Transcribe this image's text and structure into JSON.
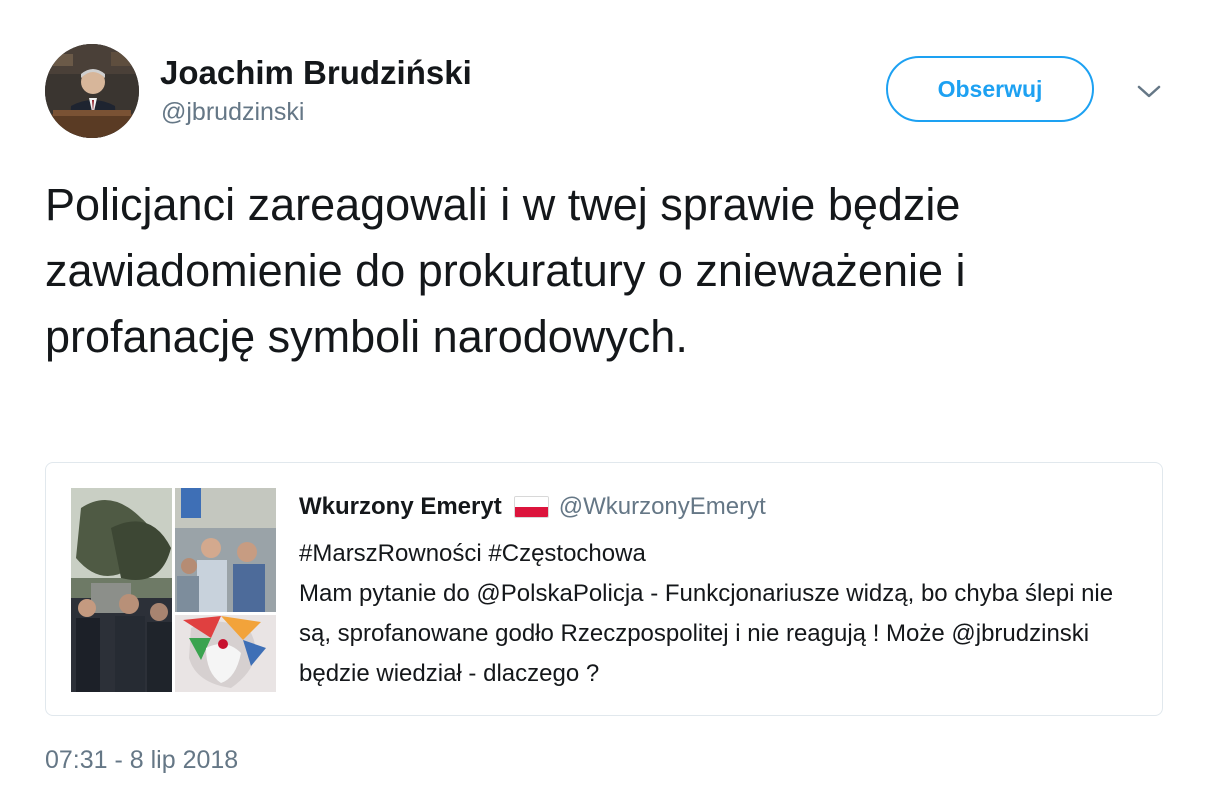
{
  "author": {
    "display_name": "Joachim Brudziński",
    "handle": "@jbrudzinski"
  },
  "follow_button_label": "Obserwuj",
  "icons": {
    "menu": "chevron-down-icon"
  },
  "tweet_text": "Policjanci zareagowali i w twej sprawie będzie zawiadomienie do prokuratury o znieważenie i profanację symboli narodowych.",
  "quoted_tweet": {
    "display_name": "Wkurzony Emeryt",
    "handle": "@WkurzonyEmeryt",
    "line1": "#MarszRowności #Częstochowa",
    "line2": "Mam pytanie do @PolskaPolicja - Funkcjonariusze widzą, bo chyba ślepi nie są, sprofanowane godło Rzeczpospolitej i nie reagują ! Może @jbrudzinski będzie wiedział - dlaczego ?"
  },
  "timestamp": "07:31 - 8 lip 2018",
  "colors": {
    "accent": "#1da1f2",
    "secondary_text": "#657786",
    "border": "#e1e8ed",
    "flag_white": "#ffffff",
    "flag_red": "#dc143c"
  }
}
